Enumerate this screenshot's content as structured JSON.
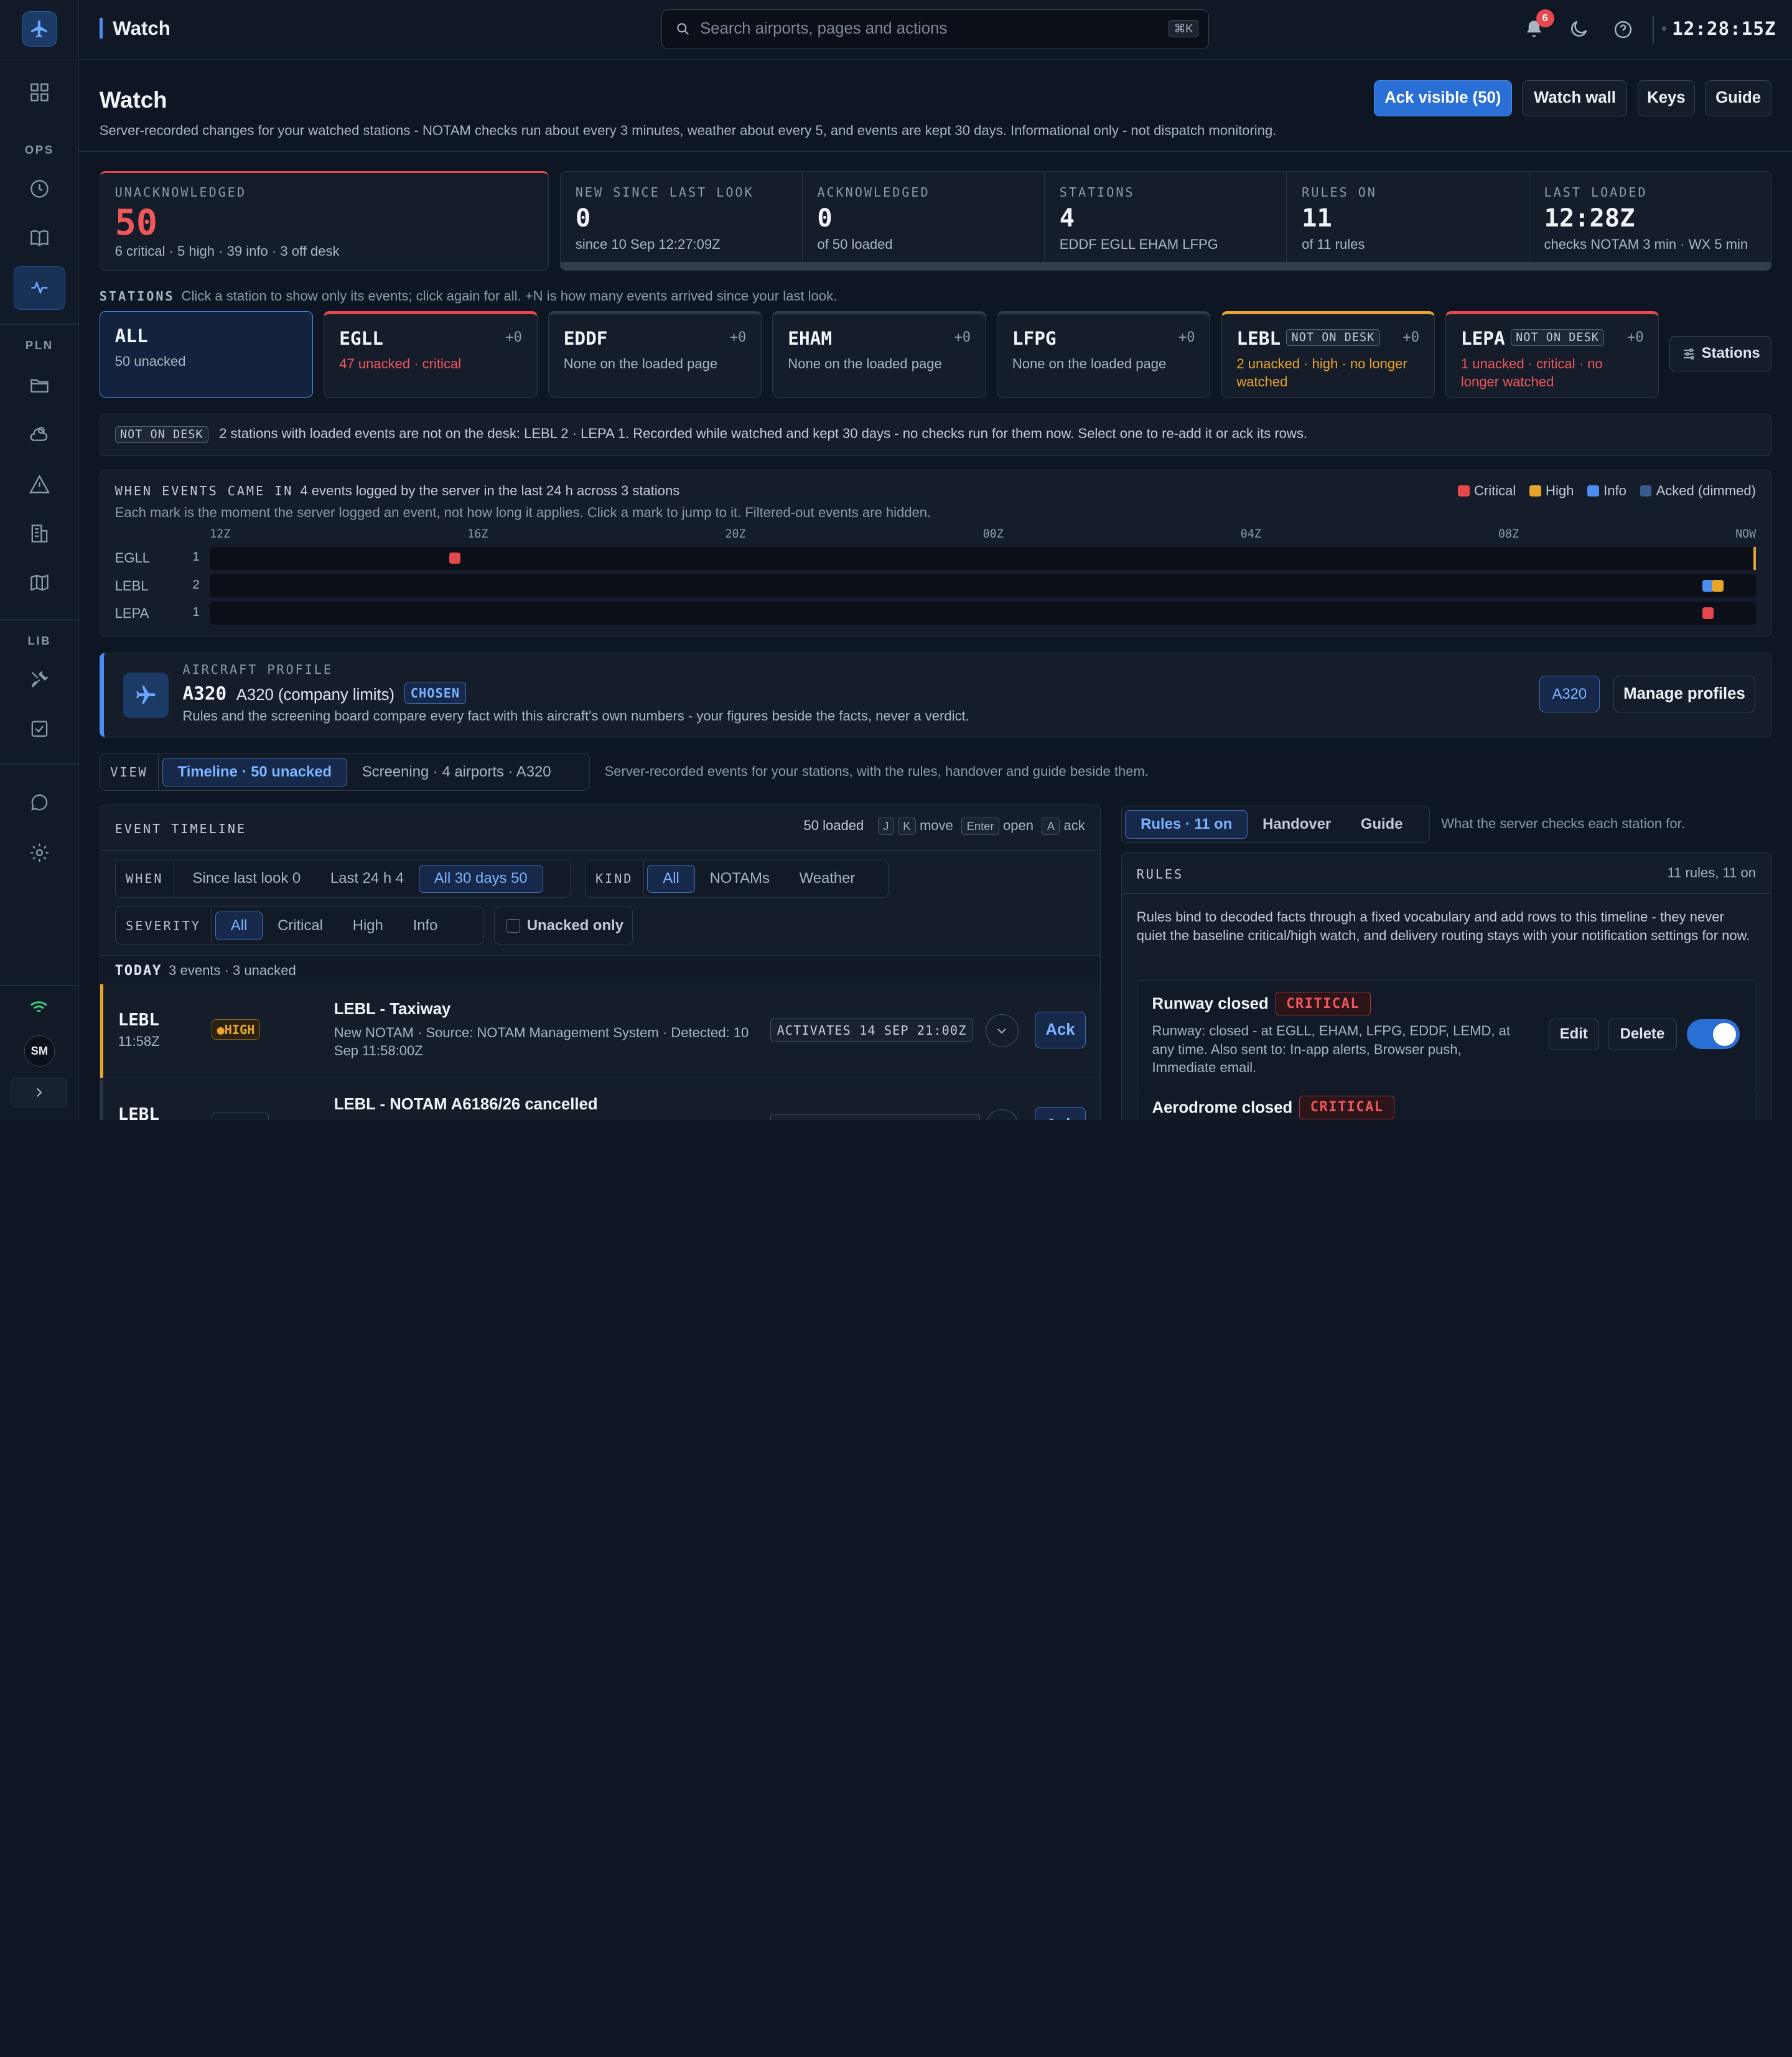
{
  "topbar": {
    "title": "Watch",
    "search_placeholder": "Search airports, pages and actions",
    "search_shortcut": "⌘K",
    "notifications_count": "6",
    "clock": "12:28:15Z"
  },
  "sidebar": {
    "sections": [
      "OPS",
      "PLN",
      "LIB"
    ],
    "user_initials": "SM",
    "icons": [
      "dashboard-icon",
      "clock-icon",
      "book-icon",
      "activity-icon",
      "folder-icon",
      "weather-icon",
      "warning-icon",
      "building-icon",
      "map-icon",
      "tools-icon",
      "checklist-icon",
      "chat-icon",
      "gear-icon"
    ]
  },
  "header": {
    "title": "Watch",
    "subtitle": "Server-recorded changes for your watched stations - NOTAM checks run about every 3 minutes, weather about every 5, and events are kept 30 days. Informational only - not dispatch monitoring.",
    "buttons": {
      "ack_visible": "Ack visible (50)",
      "watch_wall": "Watch wall",
      "keys": "Keys",
      "guide": "Guide"
    }
  },
  "summary": {
    "unack": {
      "label": "UNACKNOWLEDGED",
      "value": "50",
      "sub": "6 critical · 5 high · 39 info · 3 off desk"
    },
    "stats": [
      {
        "label": "NEW SINCE LAST LOOK",
        "value": "0",
        "sub": "since 10 Sep 12:27:09Z"
      },
      {
        "label": "ACKNOWLEDGED",
        "value": "0",
        "sub": "of 50 loaded"
      },
      {
        "label": "STATIONS",
        "value": "4",
        "sub": "EDDF EGLL EHAM LFPG"
      },
      {
        "label": "RULES ON",
        "value": "11",
        "sub": "of 11 rules"
      },
      {
        "label": "LAST LOADED",
        "value": "12:28Z",
        "sub": "checks NOTAM 3 min · WX 5 min"
      }
    ]
  },
  "stations": {
    "label": "STATIONS",
    "hint": "Click a station to show only its events; click again for all. +N is how many events arrived since your last look.",
    "not_on_desk_tag": "NOT ON DESK",
    "button": "Stations",
    "cards": [
      {
        "code": "ALL",
        "delta": "",
        "desc": "50 unacked",
        "tone": "neutral",
        "selected": true,
        "off_desk": false
      },
      {
        "code": "EGLL",
        "delta": "+0",
        "desc": "47 unacked · critical",
        "tone": "critical",
        "selected": false,
        "off_desk": false
      },
      {
        "code": "EDDF",
        "delta": "+0",
        "desc": "None on the loaded page",
        "tone": "neutral",
        "selected": false,
        "off_desk": false
      },
      {
        "code": "EHAM",
        "delta": "+0",
        "desc": "None on the loaded page",
        "tone": "neutral",
        "selected": false,
        "off_desk": false
      },
      {
        "code": "LFPG",
        "delta": "+0",
        "desc": "None on the loaded page",
        "tone": "neutral",
        "selected": false,
        "off_desk": false
      },
      {
        "code": "LEBL",
        "delta": "+0",
        "desc": "2 unacked · high · no longer watched",
        "tone": "high",
        "selected": false,
        "off_desk": true
      },
      {
        "code": "LEPA",
        "delta": "+0",
        "desc": "1 unacked · critical · no longer watched",
        "tone": "critical",
        "selected": false,
        "off_desk": true
      }
    ]
  },
  "banner": {
    "tag": "NOT ON DESK",
    "text": "2 stations with loaded events are not on the desk: LEBL 2 · LEPA 1. Recorded while watched and kept 30 days - no checks run for them now. Select one to re-add it or ack its rows."
  },
  "when_chart": {
    "title": "WHEN EVENTS CAME IN",
    "summary": "4 events logged by the server in the last 24 h across 3 stations",
    "hint": "Each mark is the moment the server logged an event, not how long it applies. Click a mark to jump to it. Filtered-out events are hidden.",
    "legend": [
      {
        "label": "Critical",
        "color": "#e5484d"
      },
      {
        "label": "High",
        "color": "#e8a52b"
      },
      {
        "label": "Info",
        "color": "#4a8ff0"
      },
      {
        "label": "Acked (dimmed)",
        "color": "#3b5b8f"
      }
    ],
    "ticks": [
      "12Z",
      "16Z",
      "20Z",
      "00Z",
      "04Z",
      "08Z",
      "NOW"
    ],
    "lanes": [
      {
        "station": "EGLL",
        "count": "1",
        "marks": [
          {
            "hours_ago": 20.0,
            "severity": "critical"
          }
        ]
      },
      {
        "station": "LEBL",
        "count": "2",
        "marks": [
          {
            "hours_ago": 0.55,
            "severity": "info"
          },
          {
            "hours_ago": 0.4,
            "severity": "high"
          }
        ]
      },
      {
        "station": "LEPA",
        "count": "1",
        "marks": [
          {
            "hours_ago": 0.55,
            "severity": "critical"
          }
        ]
      }
    ]
  },
  "aircraft": {
    "label": "AIRCRAFT PROFILE",
    "code": "A320",
    "name": "A320 (company limits)",
    "chip": "CHOSEN",
    "desc": "Rules and the screening board compare every fact with this aircraft's own numbers - your figures beside the facts, never a verdict.",
    "select_value": "A320",
    "manage": "Manage profiles"
  },
  "view": {
    "label": "VIEW",
    "options": [
      "Timeline · 50 unacked",
      "Screening · 4 airports · A320"
    ],
    "selected": 0,
    "hint": "Server-recorded events for your stations, with the rules, handover and guide beside them."
  },
  "events": {
    "title": "EVENT TIMELINE",
    "loaded": "50 loaded",
    "keys": [
      {
        "k": "J",
        "t": ""
      },
      {
        "k": "K",
        "t": "move"
      },
      {
        "k": "Enter",
        "t": "open"
      },
      {
        "k": "A",
        "t": "ack"
      }
    ],
    "when": {
      "label": "WHEN",
      "options": [
        "Since last look 0",
        "Last 24 h 4",
        "All 30 days 50"
      ],
      "selected": 2
    },
    "kind": {
      "label": "KIND",
      "options": [
        "All",
        "NOTAMs",
        "Weather"
      ],
      "selected": 0
    },
    "severity": {
      "label": "SEVERITY",
      "options": [
        "All",
        "Critical",
        "High",
        "Info"
      ],
      "selected": 0
    },
    "unacked_only": "Unacked only",
    "day": {
      "label": "TODAY",
      "summary": "3 events · 3 unacked"
    },
    "rows": [
      {
        "station": "LEBL",
        "time": "11:58Z",
        "severity": "HIGH",
        "title": "LEBL - Taxiway",
        "detail": "New NOTAM · Source: NOTAM Management System · Detected: 10 Sep 11:58:00Z",
        "tag": "ACTIVATES 14 SEP 21:00Z",
        "ack": "Ack"
      },
      {
        "station": "LEBL",
        "time": "",
        "severity": "",
        "title": "LEBL - NOTAM A6186/26 cancelled",
        "detail": "",
        "tag": "",
        "ack": "Ack"
      }
    ]
  },
  "side": {
    "tabs": [
      "Rules · 11 on",
      "Handover",
      "Guide"
    ],
    "selected": 0,
    "hint": "What the server checks each station for.",
    "rules_title": "RULES",
    "rules_count": "11 rules, 11 on",
    "rules_desc": "Rules bind to decoded facts through a fixed vocabulary and add rows to this timeline - they never quiet the baseline critical/high watch, and delivery routing stays with your notification settings for now.",
    "rules": [
      {
        "name": "Runway closed",
        "severity": "CRITICAL",
        "detail": "Runway: closed - at EGLL, EHAM, LFPG, EDDF, LEMD, at any time. Also sent to: In-app alerts, Browser push, Immediate email.",
        "edit": "Edit",
        "delete": "Delete",
        "enabled": true
      },
      {
        "name": "Aerodrome closed",
        "severity": "CRITICAL",
        "detail": "",
        "edit": "Edit",
        "delete": "Delete",
        "enabled": true
      }
    ]
  }
}
